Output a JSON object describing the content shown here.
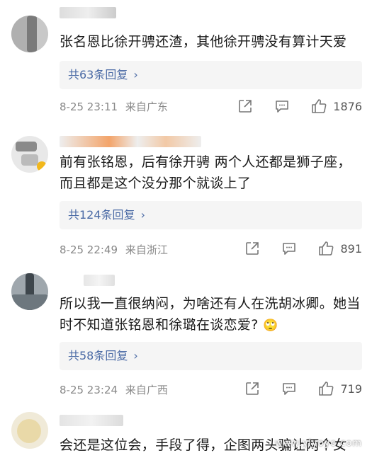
{
  "comments": [
    {
      "text": "张名恩比徐开骋还渣，其他徐开骋没有算计天爱",
      "replies": "共63条回复",
      "time": "8-25 23:11",
      "location": "来自广东",
      "likes": "1876"
    },
    {
      "text": "前有张铭恩，后有徐开骋  两个人还都是狮子座，而且都是这个没分那个就谈上了",
      "replies": "共124条回复",
      "time": "8-25 22:49",
      "location": "来自浙江",
      "likes": "891"
    },
    {
      "text": "所以我一直很纳闷，为啥还有人在洗胡冰卿。她当时不知道张铭恩和徐璐在谈恋爱?",
      "emoji": "🙄",
      "replies": "共58条回复",
      "time": "8-25 23:24",
      "location": "来自广西",
      "likes": "719"
    },
    {
      "text": "会还是这位会，手段了得，企图两头骗让两个女"
    }
  ],
  "watermark": "www.ylyoyo.com",
  "icons": [
    "share-icon",
    "comment-icon",
    "like-icon"
  ]
}
